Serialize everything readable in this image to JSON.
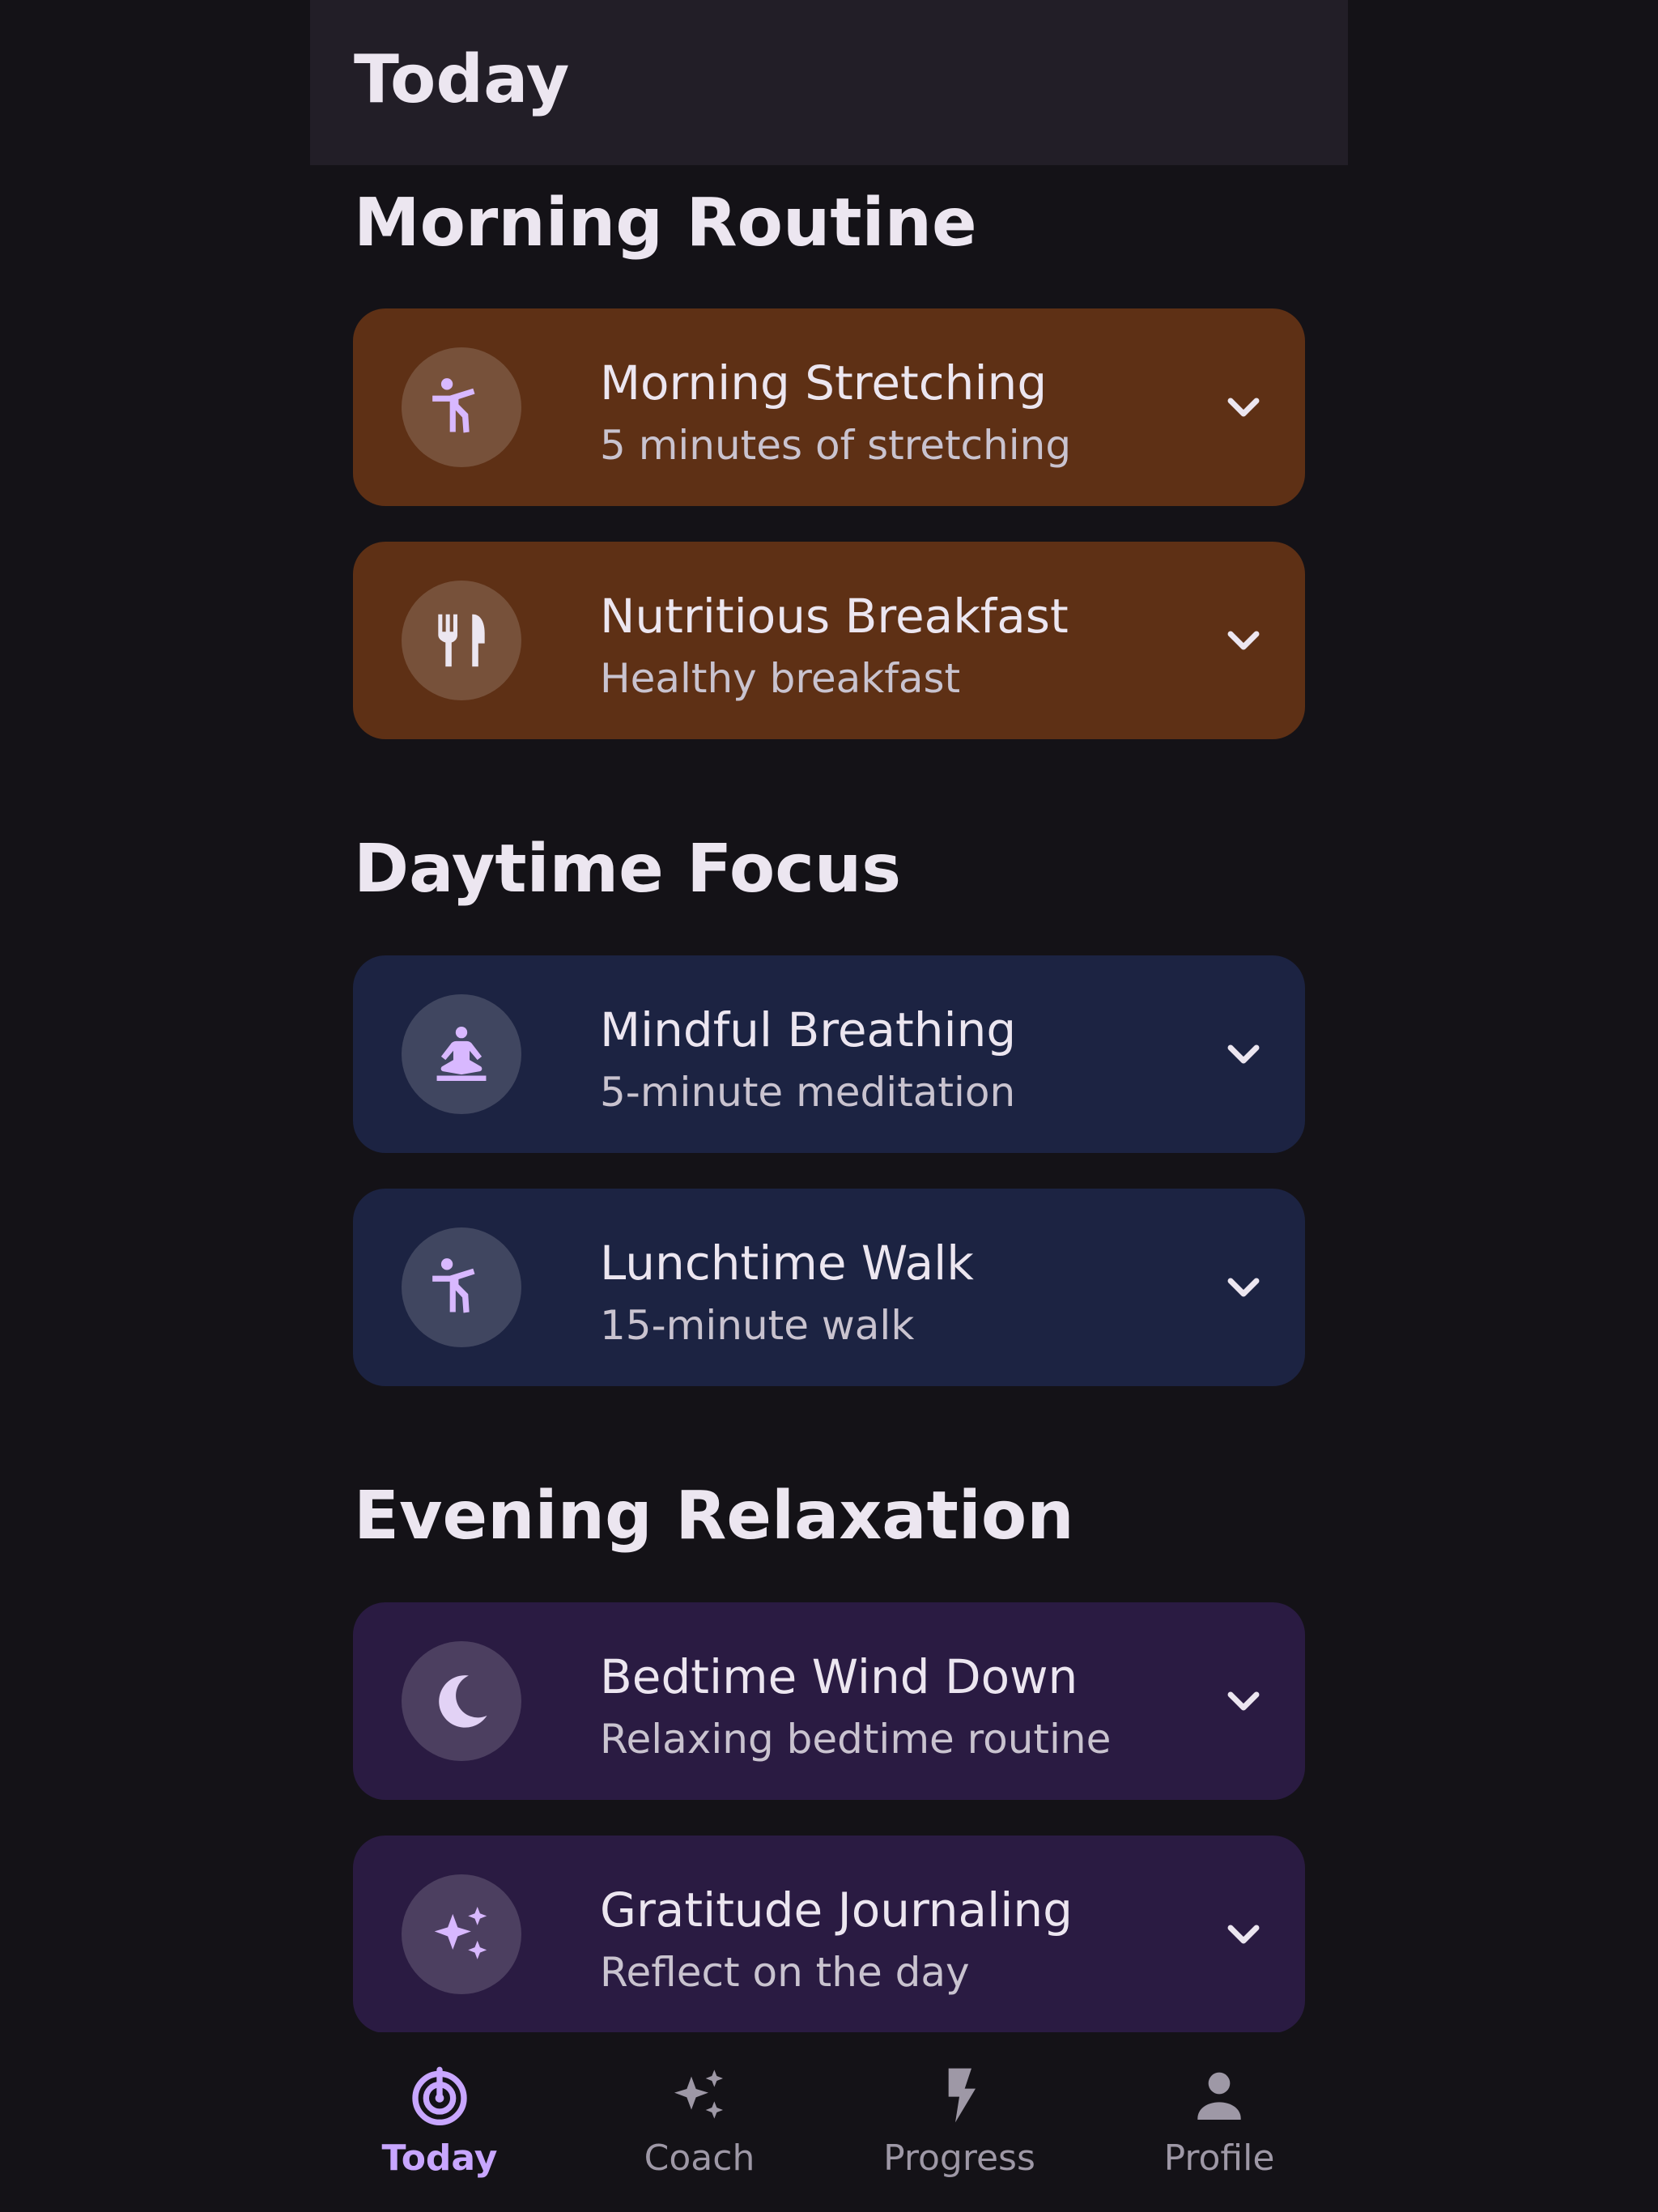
{
  "header": {
    "title": "Today"
  },
  "sections": [
    {
      "title": "Morning Routine",
      "theme": "morning",
      "items": [
        {
          "title": "Morning Stretching",
          "subtitle": "5 minutes of stretching",
          "icon": "stretch-icon"
        },
        {
          "title": "Nutritious Breakfast",
          "subtitle": "Healthy breakfast",
          "icon": "fork-knife-icon"
        }
      ]
    },
    {
      "title": "Daytime Focus",
      "theme": "daytime",
      "items": [
        {
          "title": "Mindful Breathing",
          "subtitle": "5-minute meditation",
          "icon": "meditation-icon"
        },
        {
          "title": "Lunchtime Walk",
          "subtitle": "15-minute walk",
          "icon": "stretch-icon"
        }
      ]
    },
    {
      "title": "Evening Relaxation",
      "theme": "evening",
      "items": [
        {
          "title": "Bedtime Wind Down",
          "subtitle": "Relaxing bedtime routine",
          "icon": "moon-icon"
        },
        {
          "title": "Gratitude Journaling",
          "subtitle": "Reflect on the day",
          "icon": "sparkle-icon"
        }
      ]
    }
  ],
  "nav": {
    "items": [
      {
        "label": "Today",
        "icon": "spiral-icon",
        "active": true
      },
      {
        "label": "Coach",
        "icon": "sparkle-icon",
        "active": false
      },
      {
        "label": "Progress",
        "icon": "lightning-icon",
        "active": false
      },
      {
        "label": "Profile",
        "icon": "person-icon",
        "active": false
      }
    ]
  },
  "colors": {
    "accent": "#c8a6ff",
    "morning_card": "#5e3015",
    "daytime_card": "#1c2342",
    "evening_card": "#2a1b42",
    "background": "#141217",
    "header": "#221e27"
  }
}
